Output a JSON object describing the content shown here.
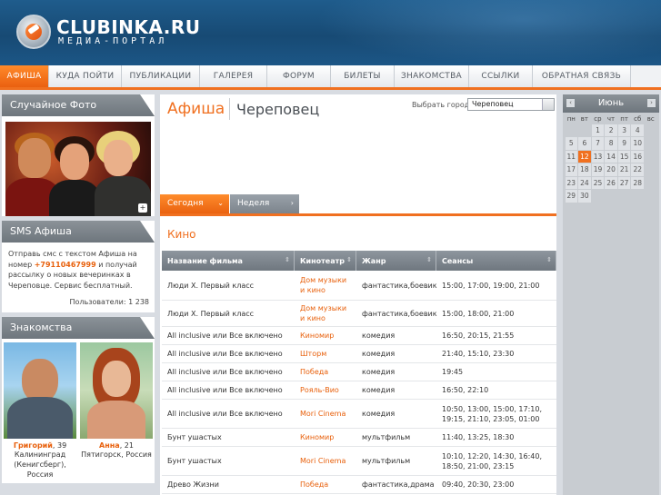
{
  "site": {
    "logo_text": "CLUBINKA.RU",
    "logo_sub": "МЕДИА-ПОРТАЛ"
  },
  "nav": [
    {
      "label": "АФИША",
      "active": true
    },
    {
      "label": "КУДА ПОЙТИ"
    },
    {
      "label": "ПУБЛИКАЦИИ"
    },
    {
      "label": "ГАЛЕРЕЯ"
    },
    {
      "label": "ФОРУМ"
    },
    {
      "label": "БИЛЕТЫ"
    },
    {
      "label": "ЗНАКОМСТВА"
    },
    {
      "label": "ССЫЛКИ"
    },
    {
      "label": "ОБРАТНАЯ СВЯЗЬ"
    }
  ],
  "left": {
    "random_photo_title": "Случайное Фото",
    "sms_title": "SMS Афиша",
    "sms_text_1": "Отправь смс с текстом Афиша на номер",
    "sms_phone": "+79110467999",
    "sms_text_2": "и получай рассылку о новых вечеринках в Череповце. Сервис бесплатный.",
    "sms_users": "Пользователи: 1 238",
    "dating_title": "Знакомства",
    "people": [
      {
        "name": "Григорий",
        "age": ", 39",
        "city": "Калининград (Кенигсберг), Россия"
      },
      {
        "name": "Анна",
        "age": ", 21",
        "city": "Пятигорск, Россия"
      }
    ]
  },
  "main": {
    "title": "Афиша",
    "city": "Череповец",
    "city_label": "Выбрать город:",
    "city_value": "Череповец",
    "tabs": {
      "today": "Сегодня",
      "week": "Неделя"
    },
    "section": "Кино",
    "columns": [
      "Название фильма",
      "Кинотеатр",
      "Жанр",
      "Сеансы"
    ],
    "rows": [
      {
        "film": "Люди Х. Первый класс",
        "cinema": "Дом музыки и кино",
        "genre": "фантастика,боевик",
        "times": "15:00, 17:00, 19:00, 21:00"
      },
      {
        "film": "Люди Х. Первый класс",
        "cinema": "Дом музыки и кино",
        "genre": "фантастика,боевик",
        "times": "15:00, 18:00, 21:00"
      },
      {
        "film": "All inclusive или Все включено",
        "cinema": "Киномир",
        "genre": "комедия",
        "times": "16:50, 20:15, 21:55"
      },
      {
        "film": "All inclusive или Все включено",
        "cinema": "Шторм",
        "genre": "комедия",
        "times": "21:40, 15:10, 23:30"
      },
      {
        "film": "All inclusive или Все включено",
        "cinema": "Победа",
        "genre": "комедия",
        "times": "19:45"
      },
      {
        "film": "All inclusive или Все включено",
        "cinema": "Рояль-Вио",
        "genre": "комедия",
        "times": "16:50, 22:10"
      },
      {
        "film": "All inclusive или Все включено",
        "cinema": "Mori Cinema",
        "genre": "комедия",
        "times": "10:50, 13:00, 15:00, 17:10, 19:15, 21:10, 23:05, 01:00"
      },
      {
        "film": "Бунт ушастых",
        "cinema": "Киномир",
        "genre": "мультфильм",
        "times": "11:40, 13:25, 18:30"
      },
      {
        "film": "Бунт ушастых",
        "cinema": "Mori Cinema",
        "genre": "мультфильм",
        "times": "10:10, 12:20, 14:30, 16:40, 18:50, 21:00, 23:15"
      },
      {
        "film": "Древо Жизни",
        "cinema": "Победа",
        "genre": "фантастика,драма",
        "times": "09:40, 20:30, 23:00"
      }
    ]
  },
  "calendar": {
    "month": "Июнь",
    "dows": [
      "пн",
      "вт",
      "ср",
      "чт",
      "пт",
      "сб",
      "вс"
    ],
    "leading_blanks": 2,
    "days": 30,
    "today": 12
  }
}
